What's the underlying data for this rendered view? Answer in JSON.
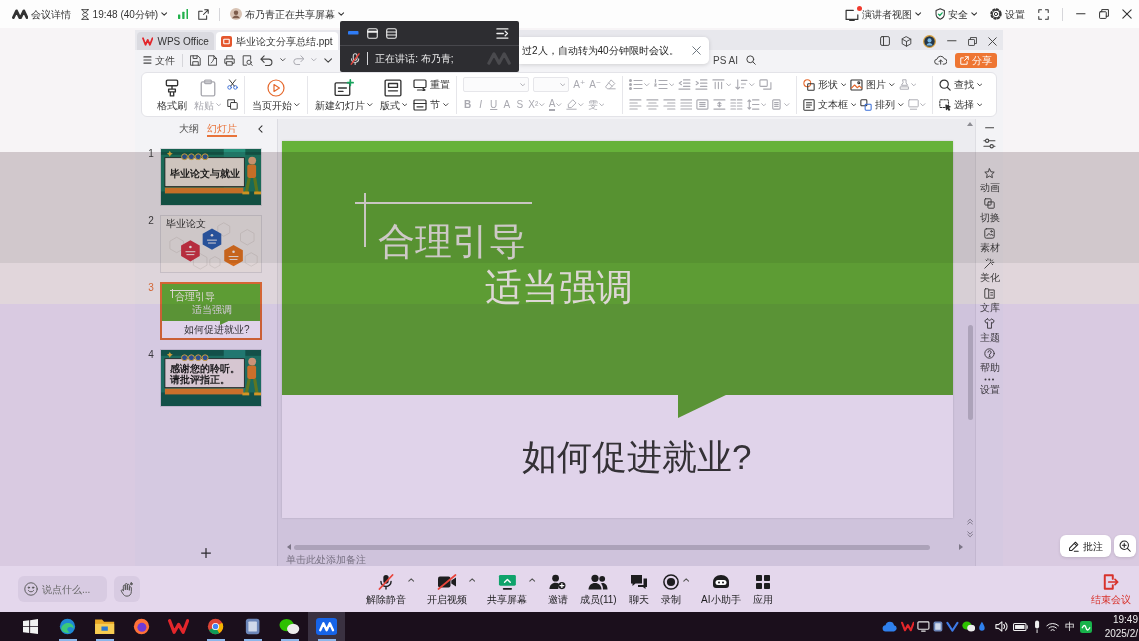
{
  "meeting_bar": {
    "title": "会议详情",
    "duration": "19:48 (40分钟)",
    "sharer": "布乃青正在共享屏幕",
    "presenter_view": {
      "label": "演讲者视图",
      "notification": true
    },
    "security": "安全",
    "settings": "设置"
  },
  "speaker_panel": {
    "view_modes": [
      {
        "selected": true
      },
      {
        "selected": false
      },
      {
        "selected": false
      }
    ],
    "mic_muted": true,
    "speaking": "正在讲话: 布乃青;"
  },
  "toast": {
    "message": "过2人，自动转为40分钟限时会议。"
  },
  "wps": {
    "tabs": [
      {
        "label": "WPS Office",
        "selected": false
      },
      {
        "label": "毕业论文分享总结.ppt",
        "selected": true
      }
    ],
    "file_menu": "文件",
    "redo_disabled": true,
    "ai_label": "PS AI",
    "share_button": "分享",
    "ribbon": [
      {
        "blocks": [
          {
            "kind": "large",
            "label": "格式刷",
            "menu": false,
            "disabled": false
          },
          {
            "kind": "large",
            "label": "粘贴",
            "menu": true,
            "disabled": true
          },
          {
            "kind": "stack",
            "upper": [
              {
                "kind": "icon",
                "menu": false,
                "disabled": false
              }
            ],
            "lower": [
              {
                "kind": "icon",
                "menu": false,
                "disabled": false
              }
            ]
          }
        ]
      },
      {
        "blocks": [
          {
            "kind": "large",
            "label": "当页开始",
            "menu": true,
            "disabled": false
          }
        ]
      },
      {
        "blocks": [
          {
            "kind": "large",
            "label": "新建幻灯片",
            "menu": true,
            "disabled": false
          },
          {
            "kind": "large",
            "label": "版式",
            "menu": true,
            "disabled": false
          },
          {
            "kind": "stack",
            "upper": [
              {
                "kind": "small",
                "label": "重置",
                "menu": false,
                "disabled": false
              }
            ],
            "lower": [
              {
                "kind": "small",
                "label": "节",
                "menu": true,
                "disabled": false
              }
            ]
          }
        ]
      },
      {
        "blocks": [
          {
            "kind": "stack",
            "upper": [
              {
                "kind": "field",
                "menu": true,
                "disabled": true
              },
              {
                "kind": "field",
                "menu": true,
                "disabled": true
              },
              {
                "kind": "glyph",
                "glyph": "A⁺",
                "menu": false,
                "disabled": true
              },
              {
                "kind": "glyph",
                "glyph": "A⁻",
                "menu": false,
                "disabled": true
              },
              {
                "kind": "icon",
                "menu": false,
                "disabled": true
              }
            ],
            "lower": [
              {
                "kind": "bold",
                "glyph": "B",
                "menu": false,
                "disabled": true
              },
              {
                "kind": "italic",
                "glyph": "I",
                "menu": false,
                "disabled": true
              },
              {
                "kind": "underline",
                "glyph": "U",
                "menu": false,
                "disabled": true
              },
              {
                "kind": "glyph",
                "glyph": "A",
                "menu": false,
                "disabled": true
              },
              {
                "kind": "glyph",
                "glyph": "S",
                "menu": false,
                "disabled": true
              },
              {
                "kind": "glyph",
                "glyph": "X²",
                "menu": true,
                "disabled": true
              },
              {
                "kind": "color",
                "glyph": "A",
                "menu": true,
                "disabled": true
              },
              {
                "kind": "icon",
                "menu": true,
                "disabled": true
              },
              {
                "kind": "glyph",
                "glyph": "雯",
                "menu": true,
                "disabled": true
              }
            ]
          }
        ]
      },
      {
        "blocks": [
          {
            "kind": "stack",
            "upper": [
              {
                "kind": "icon",
                "menu": true,
                "disabled": true
              },
              {
                "kind": "icon",
                "menu": true,
                "disabled": true
              },
              {
                "kind": "icon",
                "menu": false,
                "disabled": true
              },
              {
                "kind": "icon",
                "menu": false,
                "disabled": true
              },
              {
                "kind": "icon",
                "menu": true,
                "disabled": true
              },
              {
                "kind": "icon",
                "menu": true,
                "disabled": true
              },
              {
                "kind": "icon",
                "menu": false,
                "disabled": true
              }
            ],
            "lower": [
              {
                "kind": "icon",
                "menu": false,
                "disabled": true
              },
              {
                "kind": "icon",
                "menu": false,
                "disabled": true
              },
              {
                "kind": "icon",
                "menu": false,
                "disabled": true
              },
              {
                "kind": "icon",
                "menu": false,
                "disabled": true
              },
              {
                "kind": "icon",
                "menu": false,
                "disabled": true
              },
              {
                "kind": "icon",
                "menu": false,
                "disabled": true
              },
              {
                "kind": "icon",
                "menu": false,
                "disabled": true
              },
              {
                "kind": "icon",
                "menu": true,
                "disabled": true
              },
              {
                "kind": "icon",
                "menu": true,
                "disabled": true
              }
            ]
          }
        ]
      },
      {
        "blocks": [
          {
            "kind": "stack",
            "upper": [
              {
                "kind": "small",
                "label": "形状",
                "menu": true,
                "disabled": false
              },
              {
                "kind": "small",
                "label": "图片",
                "menu": true,
                "disabled": false
              },
              {
                "kind": "icon",
                "menu": true,
                "disabled": true
              }
            ],
            "lower": [
              {
                "kind": "small",
                "label": "文本框",
                "menu": true,
                "disabled": false
              },
              {
                "kind": "small",
                "label": "排列",
                "menu": true,
                "disabled": false
              },
              {
                "kind": "icon",
                "menu": true,
                "disabled": true
              }
            ]
          }
        ]
      },
      {
        "blocks": [
          {
            "kind": "stack",
            "upper": [
              {
                "kind": "small",
                "label": "查找",
                "menu": true,
                "disabled": false
              }
            ],
            "lower": [
              {
                "kind": "small",
                "label": "选择",
                "menu": true,
                "disabled": false
              }
            ]
          }
        ]
      }
    ],
    "panel_tabs": [
      {
        "label": "大纲",
        "selected": false
      },
      {
        "label": "幻灯片",
        "selected": true
      }
    ],
    "slides": [
      {
        "number": "1",
        "kind": "cover",
        "lines": [
          "毕业论文与就业"
        ],
        "selected": false
      },
      {
        "number": "2",
        "kind": "hexagons",
        "lines": [
          "毕业论文"
        ],
        "selected": false
      },
      {
        "number": "3",
        "kind": "split",
        "lines": [
          "合理引导",
          "适当强调"
        ],
        "question": "如何促进就业?",
        "selected": true
      },
      {
        "number": "4",
        "kind": "cover",
        "lines": [
          "感谢您的聆听。",
          "请批评指正。"
        ],
        "selected": false
      }
    ],
    "current_slide": {
      "lines": [
        "合理引导",
        "适当强调"
      ],
      "question": "如何促进就业?"
    },
    "notes": {
      "placeholder": "单击此处添加备注"
    },
    "sidebar": [
      "动画",
      "切换",
      "素材",
      "美化",
      "文库",
      "主题",
      "帮助",
      "设置"
    ]
  },
  "annotate_button": "批注",
  "meeting_toolbar": {
    "chat_input": {
      "placeholder": "说点什么..."
    },
    "controls": [
      {
        "label": "解除静音",
        "off": true,
        "menu": true
      },
      {
        "label": "开启视频",
        "off": true,
        "menu": true
      },
      {
        "label": "共享屏幕",
        "off": false,
        "menu": true
      },
      {
        "label": "邀请",
        "off": false,
        "menu": false
      },
      {
        "label": "成员(11)",
        "off": false,
        "menu": false
      },
      {
        "label": "聊天",
        "off": false,
        "menu": false
      },
      {
        "label": "录制",
        "off": false,
        "menu": true
      },
      {
        "label": "AI小助手",
        "off": false,
        "menu": false
      },
      {
        "label": "应用",
        "off": false,
        "menu": false
      }
    ],
    "end_button": "结束会议"
  },
  "taskbar": {
    "apps": [
      {
        "running": true,
        "selected": false
      },
      {
        "running": true,
        "selected": false
      },
      {
        "running": false,
        "selected": false
      },
      {
        "running": false,
        "selected": false
      },
      {
        "running": true,
        "selected": false
      },
      {
        "running": true,
        "selected": false
      },
      {
        "running": true,
        "selected": false
      },
      {
        "running": true,
        "selected": true
      }
    ],
    "ime": "中",
    "time": "19:49",
    "date": "2025/2/"
  }
}
